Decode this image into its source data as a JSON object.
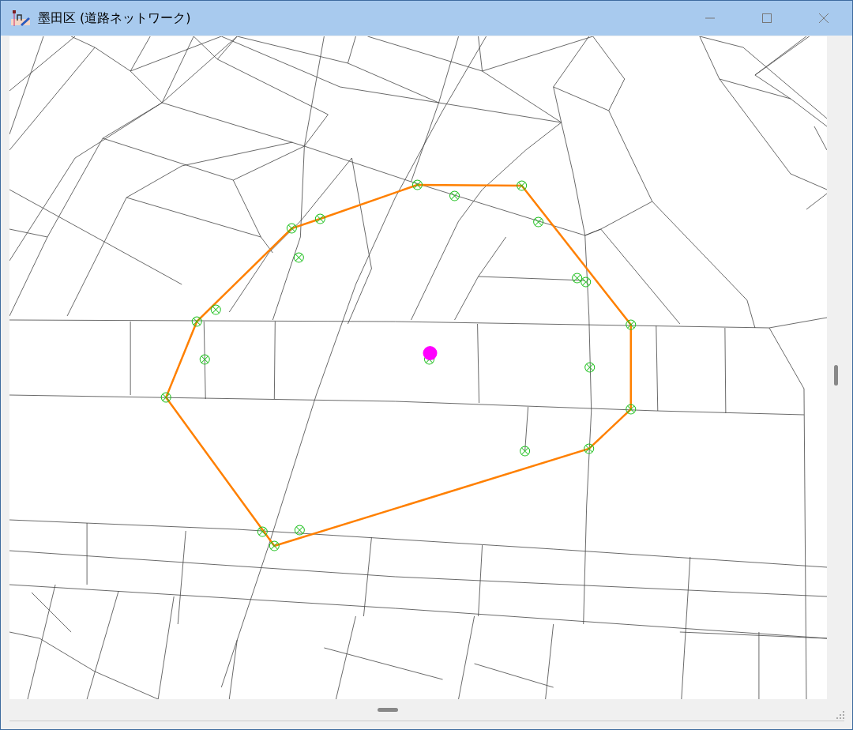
{
  "window": {
    "title": "墨田区 (道路ネットワーク)"
  }
}
